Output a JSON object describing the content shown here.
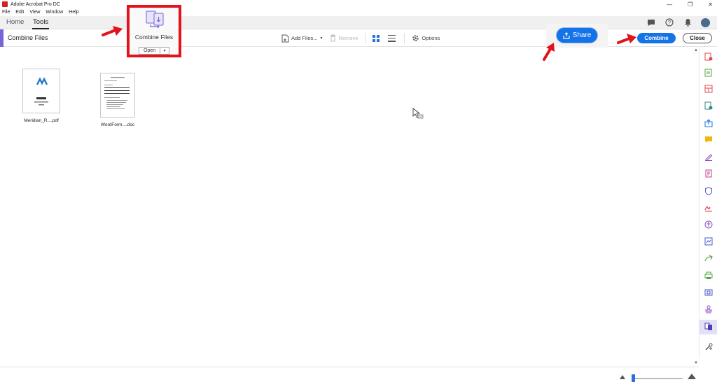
{
  "window": {
    "title": "Adobe Acrobat Pro DC",
    "controls": [
      "—",
      "❐",
      "✕"
    ]
  },
  "menu": [
    "File",
    "Edit",
    "View",
    "Window",
    "Help"
  ],
  "tabs": {
    "home": "Home",
    "tools": "Tools"
  },
  "toolbar": {
    "title": "Combine Files",
    "add_files": "Add Files...",
    "remove": "Remove",
    "options": "Options",
    "combine": "Combine",
    "close": "Close"
  },
  "share": {
    "label": "Share"
  },
  "popup": {
    "title": "Combine Files",
    "open": "Open",
    "dropdown": "▾"
  },
  "files": [
    {
      "label": "Meridian_R....pdf"
    },
    {
      "label": "WordForm....doc"
    }
  ],
  "colors": {
    "accent": "#1473e6",
    "highlight": "#e3121b",
    "arrow": "#e3121b",
    "tool_accent": "#7466d8"
  }
}
